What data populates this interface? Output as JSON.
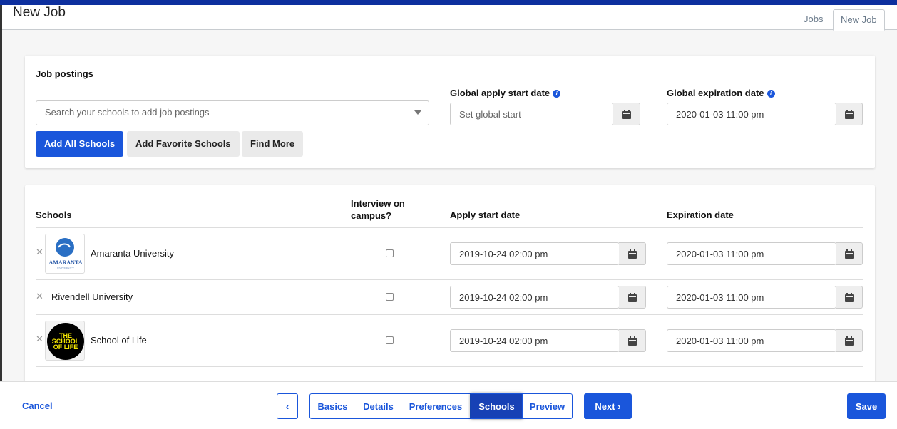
{
  "header": {
    "title": "New Job",
    "tabs": [
      {
        "label": "Jobs"
      },
      {
        "label": "New Job"
      }
    ]
  },
  "postings": {
    "title": "Job postings",
    "search_placeholder": "Search your schools to add job postings",
    "global_start_label": "Global apply start date",
    "global_start_placeholder": "Set global start",
    "global_exp_label": "Global expiration date",
    "global_exp_value": "2020-01-03 11:00 pm",
    "buttons": [
      "Add All Schools",
      "Add Favorite Schools",
      "Find More"
    ]
  },
  "table": {
    "headers": {
      "schools": "Schools",
      "interview": "Interview on campus?",
      "start": "Apply start date",
      "exp": "Expiration date"
    },
    "rows": [
      {
        "name": "Amaranta University",
        "logo_text": "AMARANTA",
        "logo_sub": "UNIVERSITY",
        "interview": false,
        "start": "2019-10-24 02:00 pm",
        "exp": "2020-01-03 11:00 pm"
      },
      {
        "name": "Rivendell University",
        "interview": false,
        "start": "2019-10-24 02:00 pm",
        "exp": "2020-01-03 11:00 pm"
      },
      {
        "name": "School of Life",
        "logo_text": "THE SCHOOL OF LIFE",
        "interview": false,
        "start": "2019-10-24 02:00 pm",
        "exp": "2020-01-03 11:00 pm"
      }
    ]
  },
  "footer": {
    "cancel": "Cancel",
    "steps": [
      "Basics",
      "Details",
      "Preferences",
      "Schools",
      "Preview"
    ],
    "active_step": "Schools",
    "next": "Next",
    "save": "Save"
  },
  "colors": {
    "primary": "#1a56db",
    "topbar": "#0d2f9e"
  }
}
